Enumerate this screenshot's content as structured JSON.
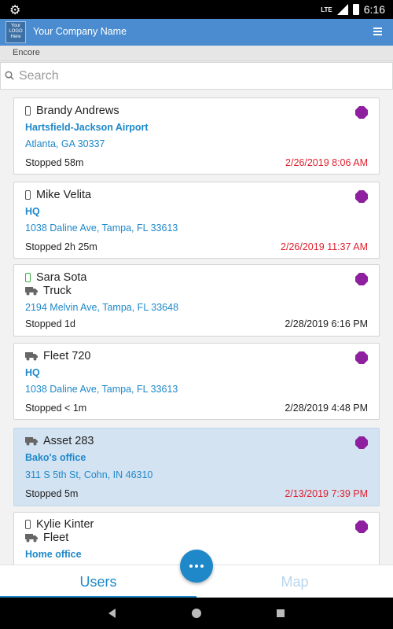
{
  "status_bar": {
    "network": "LTE",
    "time": "6:16"
  },
  "header": {
    "logo_text": "Your LOGO Here",
    "company_name": "Your Company Name"
  },
  "subheader": {
    "label": "Encore"
  },
  "search": {
    "placeholder": "Search",
    "value": ""
  },
  "cards": [
    {
      "name": "Brandy Andrews",
      "device": "phone",
      "place": "Hartsfield-Jackson Airport",
      "address": "Atlanta, GA 30337",
      "status": "Stopped 58m",
      "time": "2/26/2019 8:06 AM",
      "time_color": "red",
      "selected": false
    },
    {
      "name": "Mike Velita",
      "device": "phone",
      "place": "HQ",
      "address": "1038 Daline  Ave, Tampa, FL 33613",
      "status": "Stopped 2h 25m",
      "time": "2/26/2019 11:37 AM",
      "time_color": "red",
      "selected": false
    },
    {
      "name": "Sara Sota",
      "device": "phone-green",
      "vehicle": "Truck",
      "address": "2194 Melvin Ave, Tampa, FL 33648",
      "status": "Stopped 1d",
      "time": "2/28/2019 6:16 PM",
      "time_color": "dark",
      "selected": false
    },
    {
      "name": "Fleet 720",
      "device": "truck",
      "place": "HQ",
      "address": "1038 Daline  Ave, Tampa, FL 33613",
      "status": "Stopped < 1m",
      "time": "2/28/2019 4:48 PM",
      "time_color": "dark",
      "selected": false
    },
    {
      "name": "Asset 283",
      "device": "truck",
      "place": "Bako's office",
      "address": "311 S 5th  St, Cohn, IN 46310",
      "status": "Stopped 5m",
      "time": "2/13/2019 7:39 PM",
      "time_color": "red",
      "selected": true
    },
    {
      "name": "Kylie Kinter",
      "device": "phone",
      "vehicle": "Fleet",
      "place": "Home office"
    }
  ],
  "tabs": [
    {
      "label": "Users",
      "active": true
    },
    {
      "label": "Map",
      "active": false
    }
  ],
  "colors": {
    "accent": "#1e88c9",
    "header": "#4a8ccf",
    "stop_icon": "#8e1f9e",
    "late_time": "#e0202e",
    "selected_card": "#d3e3f2"
  },
  "icons": {
    "settings": "gear-icon",
    "menu": "hamburger-icon",
    "search": "search-icon",
    "stop": "stop-octagon-icon",
    "more": "more-icon"
  }
}
